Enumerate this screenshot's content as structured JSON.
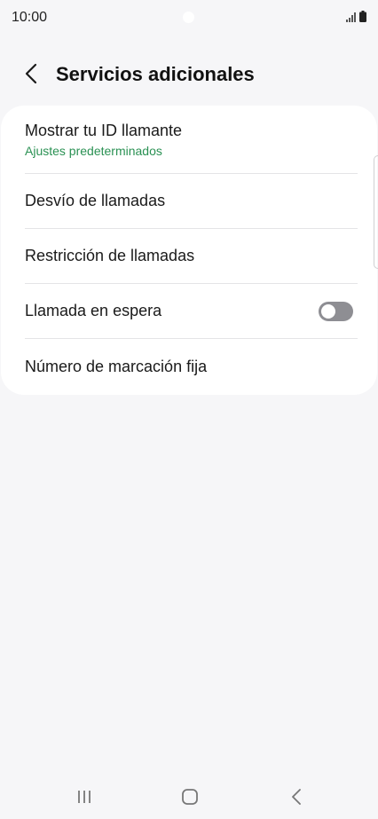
{
  "status_bar": {
    "time": "10:00"
  },
  "header": {
    "title": "Servicios adicionales"
  },
  "settings": {
    "caller_id": {
      "label": "Mostrar tu ID llamante",
      "subtitle": "Ajustes predeterminados"
    },
    "call_forwarding": {
      "label": "Desvío de llamadas"
    },
    "call_barring": {
      "label": "Restricción de llamadas"
    },
    "call_waiting": {
      "label": "Llamada en espera",
      "enabled": false
    },
    "fixed_dialing": {
      "label": "Número de marcación fija"
    }
  },
  "colors": {
    "accent_green": "#2a9153",
    "toggle_off": "#8e8e93",
    "background": "#f6f6f8",
    "card": "#ffffff"
  },
  "icons": {
    "back": "chevron-left-icon",
    "signal": "signal-icon",
    "battery": "battery-icon",
    "recents": "recents-icon",
    "home": "home-icon",
    "nav_back": "nav-back-icon"
  }
}
